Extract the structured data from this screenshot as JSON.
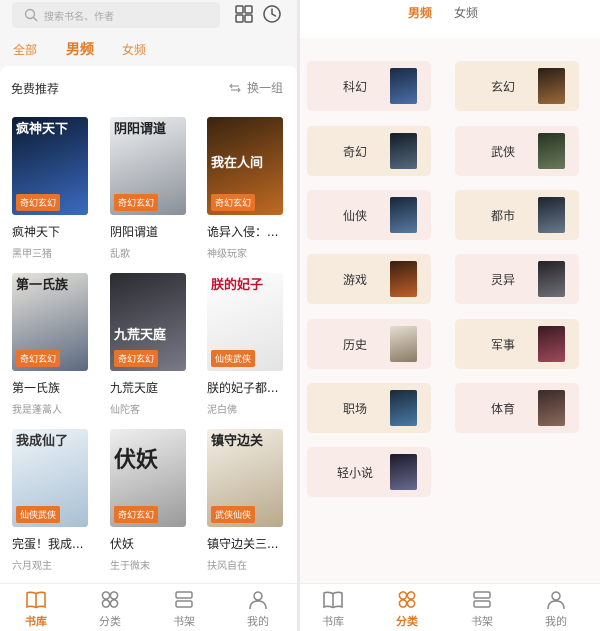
{
  "left": {
    "search": {
      "placeholder": "搜索书名、作者"
    },
    "tabs": [
      {
        "label": "全部",
        "active": false
      },
      {
        "label": "男频",
        "active": true
      },
      {
        "label": "女频",
        "active": false
      }
    ],
    "section": {
      "title": "免费推荐",
      "refresh_label": "换一组"
    },
    "books": [
      {
        "title": "疯神天下",
        "author": "黑甲三猪",
        "tag": "奇幻玄幻",
        "cover_text": "疯神天下",
        "cover_colors": [
          "#0c1a33",
          "#3b6cc0"
        ]
      },
      {
        "title": "阴阳谓道",
        "author": "乱歌",
        "tag": "奇幻玄幻",
        "cover_text": "阴阳谓道",
        "cover_colors": [
          "#eef0f2",
          "#8a9098"
        ]
      },
      {
        "title": "诡异入侵：...",
        "author": "神级玩家",
        "tag": "奇幻玄幻",
        "cover_text": "我在人间",
        "cover_colors": [
          "#3a2410",
          "#c06a22"
        ]
      },
      {
        "title": "第一氏族",
        "author": "我是蓬蒿人",
        "tag": "奇幻玄幻",
        "cover_text": "第一氏族",
        "cover_colors": [
          "#e7e3dc",
          "#5c6a80"
        ]
      },
      {
        "title": "九荒天庭",
        "author": "仙陀客",
        "tag": "奇幻玄幻",
        "cover_text": "九荒天庭",
        "cover_colors": [
          "#2a2a30",
          "#7a7a88"
        ]
      },
      {
        "title": "朕的妃子都...",
        "author": "泥白佛",
        "tag": "仙侠武侠",
        "cover_text": "朕的妃子",
        "cover_colors": [
          "#ffffff",
          "#e3e3e3"
        ]
      },
      {
        "title": "完蛋！我成...",
        "author": "六月观主",
        "tag": "仙侠武侠",
        "cover_text": "我成仙了",
        "cover_colors": [
          "#eef4f8",
          "#a8c0d4"
        ]
      },
      {
        "title": "伏妖",
        "author": "生于微末",
        "tag": "奇幻玄幻",
        "cover_text": "伏妖",
        "cover_colors": [
          "#efefef",
          "#9a9a9a"
        ]
      },
      {
        "title": "镇守边关三...",
        "author": "扶风自在",
        "tag": "武侠仙侠",
        "cover_text": "镇守边关",
        "cover_colors": [
          "#f3efe6",
          "#b9a98c"
        ]
      }
    ]
  },
  "right": {
    "tabs": [
      {
        "label": "男频",
        "active": true
      },
      {
        "label": "女频",
        "active": false
      }
    ],
    "categories": [
      {
        "label": "科幻",
        "bg": "#f9ece8",
        "thumb_colors": [
          "#1a2a44",
          "#4a6fa8"
        ]
      },
      {
        "label": "玄幻",
        "bg": "#f7ebdd",
        "thumb_colors": [
          "#2a1e16",
          "#9a6a3a"
        ]
      },
      {
        "label": "奇幻",
        "bg": "#f7ebdd",
        "thumb_colors": [
          "#141c26",
          "#566a80"
        ]
      },
      {
        "label": "武侠",
        "bg": "#f9ece8",
        "thumb_colors": [
          "#263422",
          "#6a7a5a"
        ]
      },
      {
        "label": "仙侠",
        "bg": "#f9ece8",
        "thumb_colors": [
          "#16263a",
          "#5a7aa0"
        ]
      },
      {
        "label": "都市",
        "bg": "#f7ebdd",
        "thumb_colors": [
          "#1c2430",
          "#6a7a8a"
        ]
      },
      {
        "label": "游戏",
        "bg": "#f7ebdd",
        "thumb_colors": [
          "#3a1e10",
          "#c0602a"
        ]
      },
      {
        "label": "灵异",
        "bg": "#f9ece8",
        "thumb_colors": [
          "#222226",
          "#707078"
        ]
      },
      {
        "label": "历史",
        "bg": "#f9ece8",
        "thumb_colors": [
          "#e4ddd0",
          "#8a7a66"
        ]
      },
      {
        "label": "军事",
        "bg": "#f7ebdd",
        "thumb_colors": [
          "#3a1a22",
          "#a04a5a"
        ]
      },
      {
        "label": "职场",
        "bg": "#f7ebdd",
        "thumb_colors": [
          "#1a2a3a",
          "#4a7aa8"
        ]
      },
      {
        "label": "体育",
        "bg": "#f9ece8",
        "thumb_colors": [
          "#3a2a2a",
          "#8a6a5a"
        ]
      },
      {
        "label": "轻小说",
        "bg": "#f9ece8",
        "thumb_colors": [
          "#1a1a2a",
          "#6a6a90"
        ]
      }
    ]
  },
  "nav": {
    "items": [
      {
        "label": "书库",
        "icon": "book-icon"
      },
      {
        "label": "分类",
        "icon": "category-icon"
      },
      {
        "label": "书架",
        "icon": "bookshelf-icon"
      },
      {
        "label": "我的",
        "icon": "profile-icon"
      }
    ],
    "left_active": 0,
    "right_active": 1
  },
  "colors": {
    "accent": "#e07a26",
    "tag": "#e8742a"
  }
}
